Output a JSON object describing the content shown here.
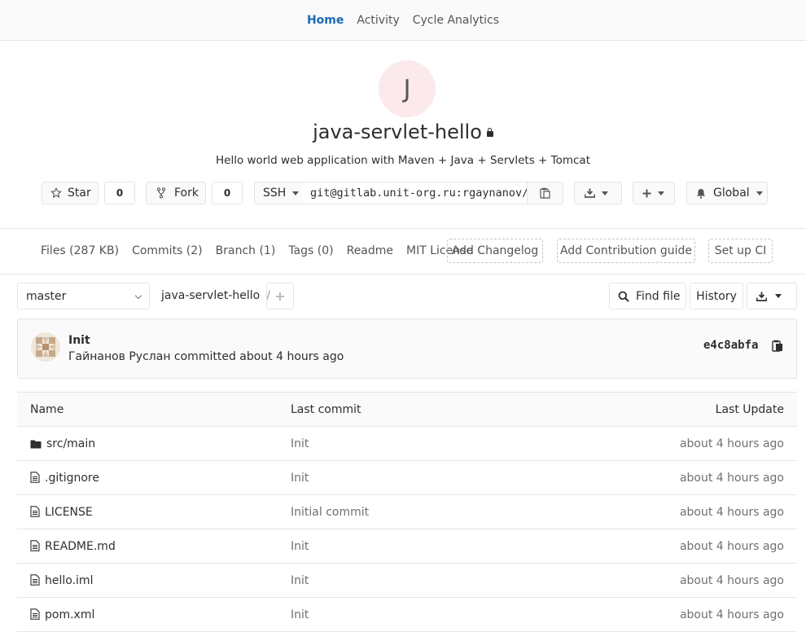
{
  "nav": {
    "home": "Home",
    "activity": "Activity",
    "cycle": "Cycle Analytics"
  },
  "project": {
    "avatar_letter": "J",
    "title": "java-servlet-hello",
    "description": "Hello world web application with Maven + Java + Servlets + Tomcat"
  },
  "actions": {
    "star_label": "Star",
    "star_count": "0",
    "fork_label": "Fork",
    "fork_count": "0",
    "protocol": "SSH",
    "clone_url": "git@gitlab.unit-org.ru:rgaynanov/java-servlet-hello.git",
    "notification": "Global"
  },
  "stats": {
    "files": "Files (287 KB)",
    "commits": "Commits (2)",
    "branch": "Branch (1)",
    "tags": "Tags (0)",
    "readme": "Readme",
    "license": "MIT License",
    "add_changelog": "Add Changelog",
    "add_contrib": "Add Contribution guide",
    "setup_ci": "Set up CI"
  },
  "repo": {
    "branch": "master",
    "path": "java-servlet-hello",
    "sep": "/",
    "find_file": "Find file",
    "history": "History"
  },
  "commit": {
    "title": "Init",
    "meta": "Гайнанов Руслан committed about 4 hours ago",
    "sha": "e4c8abfa"
  },
  "table": {
    "headers": {
      "name": "Name",
      "last_commit": "Last commit",
      "last_update": "Last Update"
    },
    "rows": [
      {
        "type": "folder",
        "name": "src/main",
        "commit": "Init",
        "updated": "about 4 hours ago"
      },
      {
        "type": "file",
        "name": ".gitignore",
        "commit": "Init",
        "updated": "about 4 hours ago"
      },
      {
        "type": "file",
        "name": "LICENSE",
        "commit": "Initial commit",
        "updated": "about 4 hours ago"
      },
      {
        "type": "file",
        "name": "README.md",
        "commit": "Init",
        "updated": "about 4 hours ago"
      },
      {
        "type": "file",
        "name": "hello.iml",
        "commit": "Init",
        "updated": "about 4 hours ago"
      },
      {
        "type": "file",
        "name": "pom.xml",
        "commit": "Init",
        "updated": "about 4 hours ago"
      }
    ]
  }
}
